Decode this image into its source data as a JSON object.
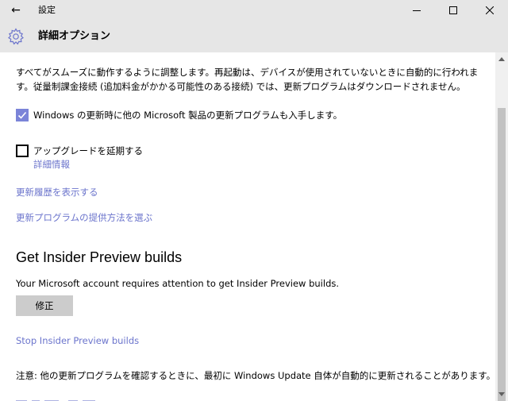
{
  "window": {
    "title": "設定",
    "back_glyph": "←"
  },
  "header": {
    "title": "詳細オプション"
  },
  "main": {
    "description": "すべてがスムーズに動作するように調整します。再起動は、デバイスが使用されていないときに自動的に行われます。従量制課金接続 (追加料金がかかる可能性のある接続) では、更新プログラムはダウンロードされません。",
    "checkbox_other_products": {
      "label": "Windows の更新時に他の Microsoft 製品の更新プログラムも入手します。",
      "checked": true
    },
    "checkbox_defer": {
      "label": "アップグレードを延期する",
      "checked": false
    },
    "details_link": "詳細情報",
    "view_history_link": "更新履歴を表示する",
    "delivery_link": "更新プログラムの提供方法を選ぶ",
    "insider": {
      "title": "Get Insider Preview builds",
      "message": "Your Microsoft account requires attention to get Insider Preview builds.",
      "fix_button": "修正",
      "stop_link": "Stop Insider Preview builds"
    },
    "note": "注意: 他の更新プログラムを確認するときに、最初に Windows Update 自体が自動的に更新されることがあります。"
  },
  "colors": {
    "accent": "#7b84d8",
    "link": "#6b74cc",
    "chrome": "#e6e6e6"
  }
}
